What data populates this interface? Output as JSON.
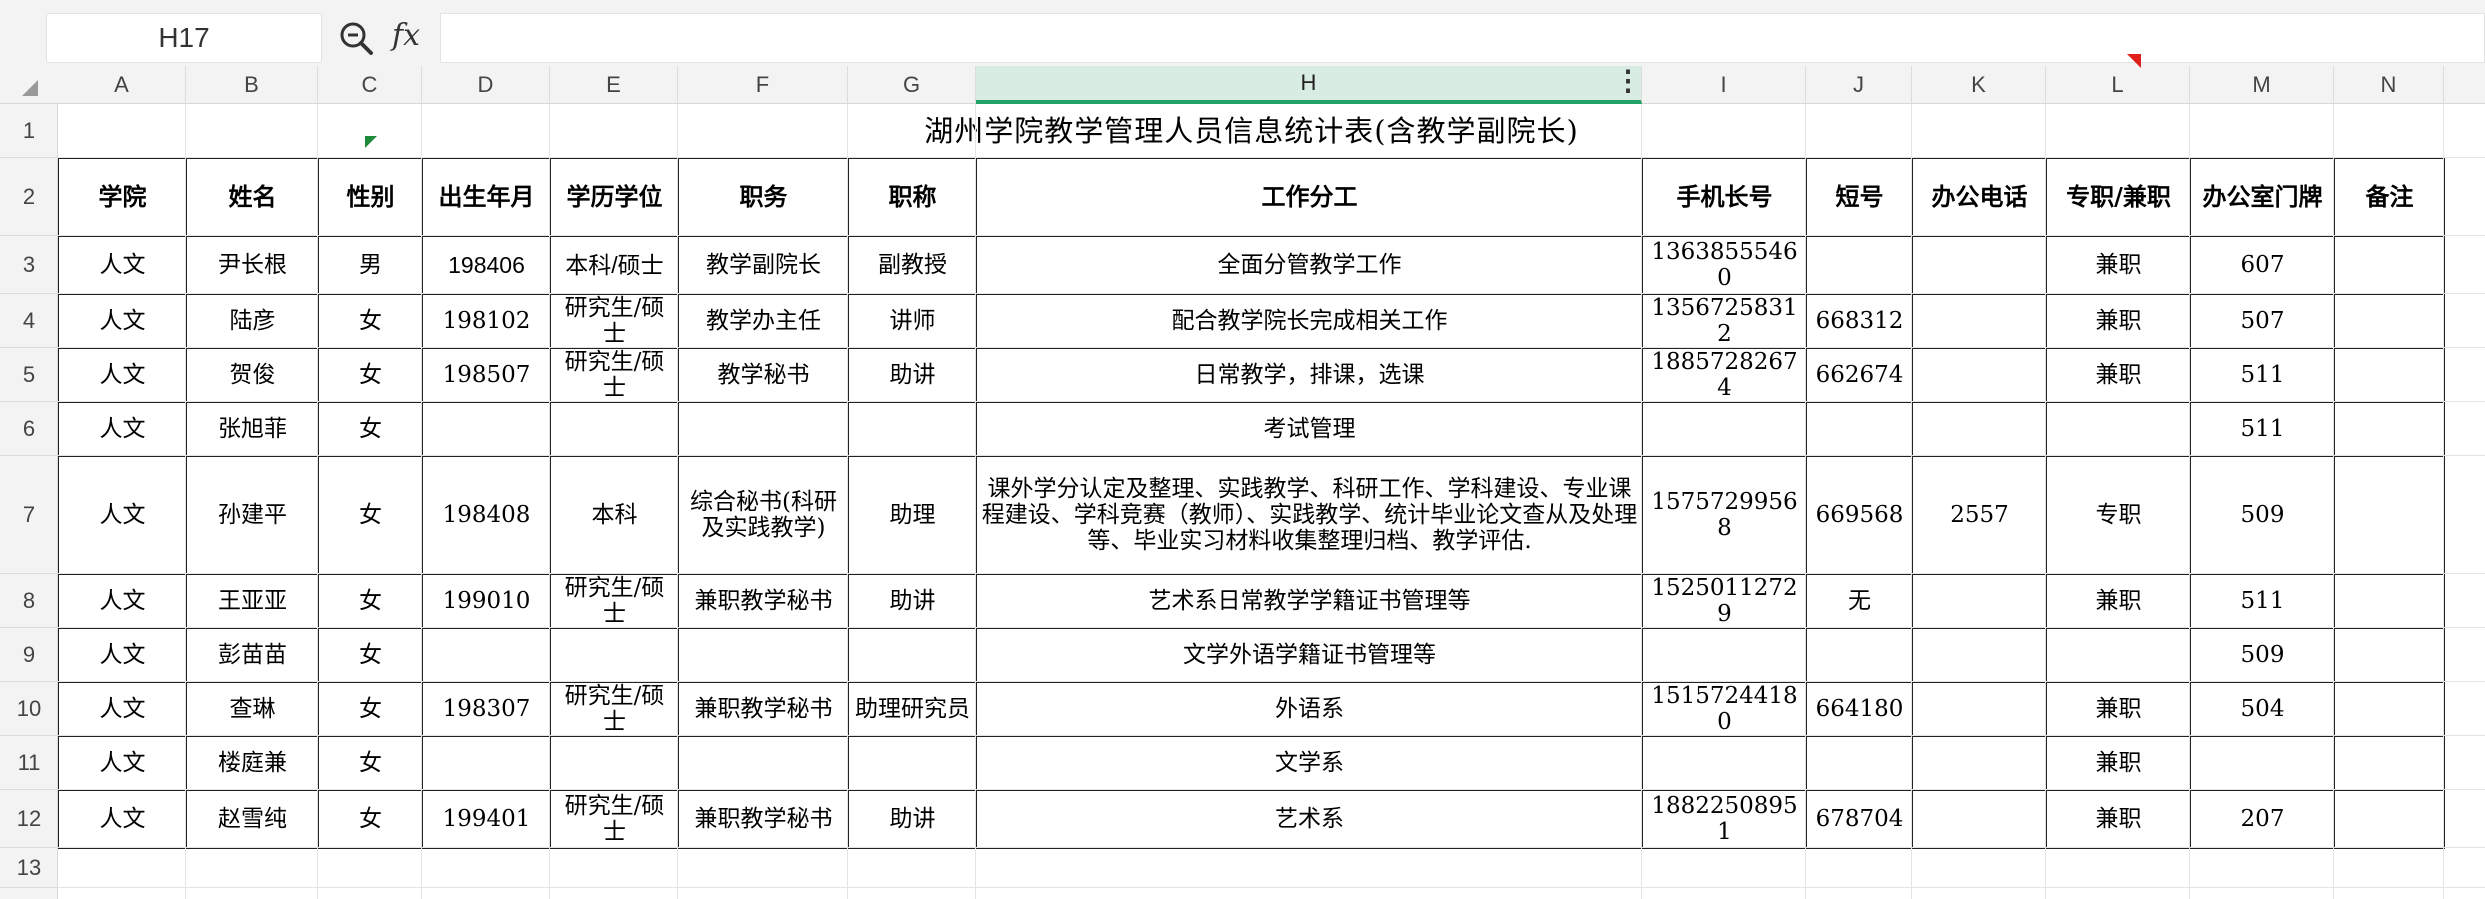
{
  "formula_bar": {
    "cell_ref": "H17",
    "zoom_icon": "zoom-search-icon",
    "fx_label": "fx",
    "formula_value": ""
  },
  "columns": [
    "A",
    "B",
    "C",
    "D",
    "E",
    "F",
    "G",
    "H",
    "I",
    "J",
    "K",
    "L",
    "M",
    "N"
  ],
  "selected_column": "H",
  "rows": [
    "1",
    "2",
    "3",
    "4",
    "5",
    "6",
    "7",
    "8",
    "9",
    "10",
    "11",
    "12",
    "13"
  ],
  "sheet": {
    "title": "湖州学院教学管理人员信息统计表(含教学副院长)",
    "headers": [
      "学院",
      "姓名",
      "性别",
      "出生年月",
      "学历学位",
      "职务",
      "职称",
      "工作分工",
      "手机长号",
      "短号",
      "办公电话",
      "专职/兼职",
      "办公室门牌",
      "备注"
    ],
    "records": [
      [
        "人文",
        "尹长根",
        "男",
        "198406",
        "本科/硕士",
        "教学副院长",
        "副教授",
        "全面分管教学工作",
        "13638555460",
        "",
        "",
        "兼职",
        "607",
        ""
      ],
      [
        "人文",
        "陆彦",
        "女",
        "198102",
        "研究生/硕士",
        "教学办主任",
        "讲师",
        "配合教学院长完成相关工作",
        "13567258312",
        "668312",
        "",
        "兼职",
        "507",
        ""
      ],
      [
        "人文",
        "贺俊",
        "女",
        "198507",
        "研究生/硕士",
        "教学秘书",
        "助讲",
        "日常教学，排课，选课",
        "18857282674",
        "662674",
        "",
        "兼职",
        "511",
        ""
      ],
      [
        "人文",
        "张旭菲",
        "女",
        "",
        "",
        "",
        "",
        "考试管理",
        "",
        "",
        "",
        "",
        "511",
        ""
      ],
      [
        "人文",
        "孙建平",
        "女",
        "198408",
        "本科",
        "综合秘书(科研及实践教学)",
        "助理",
        "课外学分认定及整理、实践教学、科研工作、学科建设、专业课程建设、学科竞赛（教师）、实践教学、统计毕业论文查从及处理等、毕业实习材料收集整理归档、教学评估.",
        "15757299568",
        "669568",
        "2557",
        "专职",
        "509",
        ""
      ],
      [
        "人文",
        "王亚亚",
        "女",
        "199010",
        "研究生/硕士",
        "兼职教学秘书",
        "助讲",
        "艺术系日常教学学籍证书管理等",
        "15250112729",
        "无",
        "",
        "兼职",
        "511",
        ""
      ],
      [
        "人文",
        "彭苗苗",
        "女",
        "",
        "",
        "",
        "",
        "文学外语学籍证书管理等",
        "",
        "",
        "",
        "",
        "509",
        ""
      ],
      [
        "人文",
        "查琳",
        "女",
        "198307",
        "研究生/硕士",
        "兼职教学秘书",
        "助理研究员",
        "外语系",
        "15157244180",
        "664180",
        "",
        "兼职",
        "504",
        ""
      ],
      [
        "人文",
        "楼庭兼",
        "女",
        "",
        "",
        "",
        "",
        "文学系",
        "",
        "",
        "",
        "兼职",
        "",
        ""
      ],
      [
        "人文",
        "赵雪纯",
        "女",
        "199401",
        "研究生/硕士",
        "兼职教学秘书",
        "助讲",
        "艺术系",
        "18822508951",
        "678704",
        "",
        "兼职",
        "207",
        ""
      ]
    ]
  },
  "colors": {
    "accent_green": "#21a366",
    "selected_col_bg": "#d8ece3",
    "comment_marker": "#e0201b",
    "error_marker": "#1e8a3c"
  }
}
